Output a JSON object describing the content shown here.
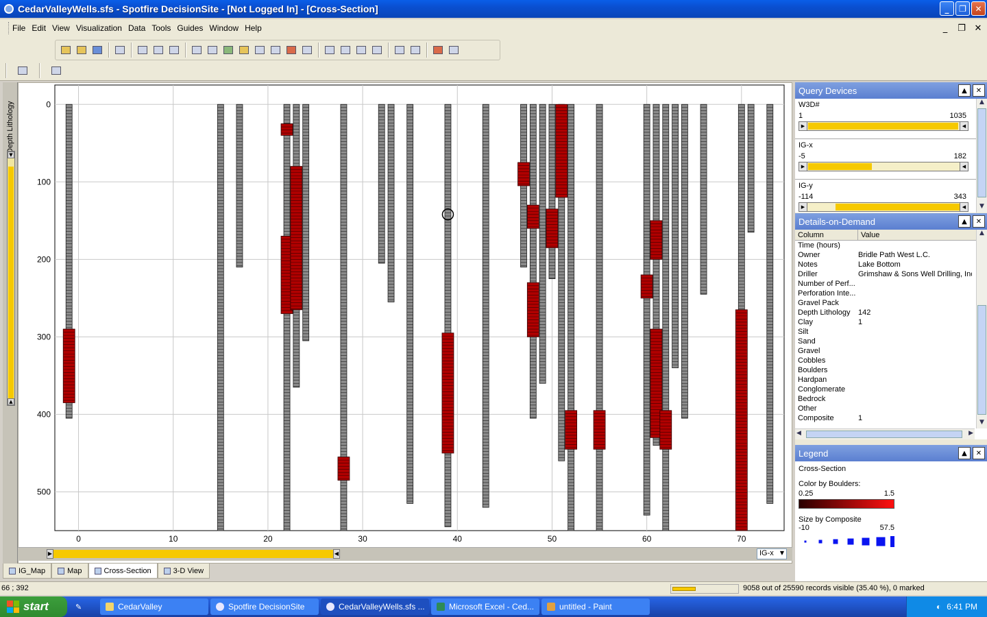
{
  "window": {
    "title": "CedarValleyWells.sfs - Spotfire DecisionSite - [Not Logged In] - [Cross-Section]",
    "minimize": "_",
    "restore": "❐",
    "close": "✕"
  },
  "menu": [
    "File",
    "Edit",
    "View",
    "Visualization",
    "Data",
    "Tools",
    "Guides",
    "Window",
    "Help"
  ],
  "left_panel": {
    "label": "Depth Lithology"
  },
  "chart_data": {
    "type": "scatter",
    "title": "",
    "xlabel": "IG-x",
    "ylabel": "Depth Lithology",
    "xlim": [
      -2.5,
      74.5
    ],
    "ylim": [
      -25,
      550
    ],
    "y_inverted": true,
    "grid": true,
    "x_ticks": [
      0,
      10,
      20,
      30,
      40,
      50,
      60,
      70
    ],
    "y_ticks": [
      0,
      100,
      200,
      300,
      400,
      500
    ],
    "color_by": "Boulders",
    "color_range": [
      0.25,
      1.5
    ],
    "size_by": "Composite",
    "size_range": [
      -10,
      57.5
    ],
    "wells": [
      {
        "x": -1,
        "top": 0,
        "bottom": 405,
        "red": [
          [
            290,
            385
          ]
        ]
      },
      {
        "x": 15,
        "top": 0,
        "bottom": 550,
        "red": []
      },
      {
        "x": 17,
        "top": 0,
        "bottom": 210,
        "red": []
      },
      {
        "x": 22,
        "top": 0,
        "bottom": 550,
        "red": [
          [
            25,
            40
          ],
          [
            170,
            270
          ]
        ]
      },
      {
        "x": 23,
        "top": 0,
        "bottom": 365,
        "red": [
          [
            80,
            265
          ]
        ]
      },
      {
        "x": 24,
        "top": 0,
        "bottom": 305,
        "red": []
      },
      {
        "x": 28,
        "top": 0,
        "bottom": 550,
        "red": [
          [
            455,
            485
          ]
        ]
      },
      {
        "x": 32,
        "top": 0,
        "bottom": 205,
        "red": []
      },
      {
        "x": 33,
        "top": 0,
        "bottom": 255,
        "red": []
      },
      {
        "x": 35,
        "top": 0,
        "bottom": 515,
        "red": []
      },
      {
        "x": 39,
        "top": 0,
        "bottom": 545,
        "red": [
          [
            295,
            450
          ]
        ]
      },
      {
        "x": 43,
        "top": 0,
        "bottom": 520,
        "red": []
      },
      {
        "x": 47,
        "top": 0,
        "bottom": 210,
        "red": [
          [
            75,
            105
          ]
        ]
      },
      {
        "x": 48,
        "top": 0,
        "bottom": 405,
        "red": [
          [
            130,
            160
          ],
          [
            230,
            300
          ]
        ]
      },
      {
        "x": 49,
        "top": 0,
        "bottom": 360,
        "red": []
      },
      {
        "x": 50,
        "top": 0,
        "bottom": 225,
        "red": [
          [
            135,
            185
          ]
        ]
      },
      {
        "x": 51,
        "top": 0,
        "bottom": 460,
        "red": [
          [
            0,
            120
          ]
        ]
      },
      {
        "x": 52,
        "top": 0,
        "bottom": 550,
        "red": [
          [
            395,
            445
          ]
        ]
      },
      {
        "x": 55,
        "top": 0,
        "bottom": 550,
        "red": [
          [
            395,
            445
          ]
        ]
      },
      {
        "x": 60,
        "top": 0,
        "bottom": 530,
        "red": [
          [
            220,
            250
          ]
        ]
      },
      {
        "x": 61,
        "top": 0,
        "bottom": 440,
        "red": [
          [
            150,
            200
          ],
          [
            290,
            430
          ]
        ]
      },
      {
        "x": 62,
        "top": 0,
        "bottom": 550,
        "red": [
          [
            395,
            445
          ]
        ]
      },
      {
        "x": 63,
        "top": 0,
        "bottom": 340,
        "red": []
      },
      {
        "x": 64,
        "top": 0,
        "bottom": 405,
        "red": []
      },
      {
        "x": 66,
        "top": 0,
        "bottom": 245,
        "red": []
      },
      {
        "x": 70,
        "top": 0,
        "bottom": 550,
        "red": [
          [
            265,
            550
          ]
        ]
      },
      {
        "x": 71,
        "top": 0,
        "bottom": 165,
        "red": []
      },
      {
        "x": 73,
        "top": 0,
        "bottom": 515,
        "red": []
      }
    ],
    "marker": {
      "x": 39,
      "y": 142
    }
  },
  "axis_selector": {
    "label": "IG-x"
  },
  "tabs": [
    {
      "label": "IG_Map",
      "active": false
    },
    {
      "label": "Map",
      "active": false
    },
    {
      "label": "Cross-Section",
      "active": true
    },
    {
      "label": "3-D View",
      "active": false
    }
  ],
  "query_devices": {
    "title": "Query Devices",
    "items": [
      {
        "name": "W3D#",
        "min": "1",
        "max": "1035",
        "fill_from": 0.0,
        "fill_to": 0.985
      },
      {
        "name": "IG-x",
        "min": "-5",
        "max": "182",
        "fill_from": 0.0,
        "fill_to": 0.42
      },
      {
        "name": "IG-y",
        "min": "-114",
        "max": "343",
        "fill_from": 0.18,
        "fill_to": 1.0
      }
    ]
  },
  "details": {
    "title": "Details-on-Demand",
    "col_header": "Column",
    "val_header": "Value",
    "rows": [
      {
        "k": "Time (hours)",
        "v": ""
      },
      {
        "k": "Owner",
        "v": "Bridle Path West L.C."
      },
      {
        "k": "Notes",
        "v": "Lake Bottom"
      },
      {
        "k": "Driller",
        "v": "Grimshaw & Sons Well Drilling, Inc."
      },
      {
        "k": "Number of Perf...",
        "v": ""
      },
      {
        "k": "Perforation Inte...",
        "v": ""
      },
      {
        "k": "Gravel Pack",
        "v": ""
      },
      {
        "k": "Depth Lithology",
        "v": "142"
      },
      {
        "k": "Clay",
        "v": "1"
      },
      {
        "k": "Silt",
        "v": ""
      },
      {
        "k": "Sand",
        "v": ""
      },
      {
        "k": "Gravel",
        "v": ""
      },
      {
        "k": "Cobbles",
        "v": ""
      },
      {
        "k": "Boulders",
        "v": ""
      },
      {
        "k": "Hardpan",
        "v": ""
      },
      {
        "k": "Conglomerate",
        "v": ""
      },
      {
        "k": "Bedrock",
        "v": ""
      },
      {
        "k": "Other",
        "v": ""
      },
      {
        "k": "Composite",
        "v": "1"
      }
    ]
  },
  "legend": {
    "title": "Legend",
    "view_name": "Cross-Section",
    "color_label": "Color by Boulders:",
    "color_min": "0.25",
    "color_max": "1.5",
    "size_label": "Size by Composite",
    "size_min": "-10",
    "size_max": "57.5",
    "colors": {
      "low": "#2a0000",
      "high": "#ff1010",
      "size_marker": "#0a14f0"
    }
  },
  "status": {
    "coords": "66 ; 392",
    "records": "9058 out of 25590 records visible (35.40 %), 0 marked",
    "visible_fraction": 0.354
  },
  "taskbar": {
    "start": "start",
    "tasks": [
      {
        "label": "CedarValley",
        "active": false
      },
      {
        "label": "Spotfire DecisionSite",
        "active": false
      },
      {
        "label": "CedarValleyWells.sfs ...",
        "active": true
      },
      {
        "label": "Microsoft Excel - Ced...",
        "active": false
      },
      {
        "label": "untitled - Paint",
        "active": false
      }
    ],
    "clock": "6:41 PM"
  }
}
